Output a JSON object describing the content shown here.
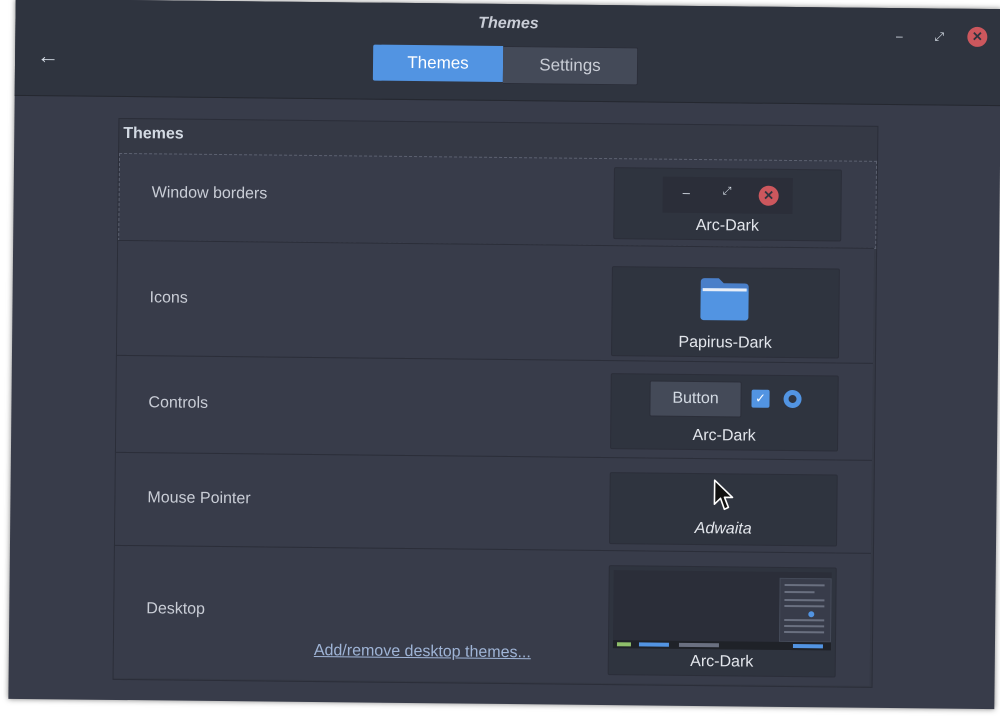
{
  "window": {
    "title": "Themes",
    "controls": {
      "minimize": "–",
      "maximize": "⤢",
      "close": "✕"
    }
  },
  "header": {
    "back_icon": "arrow-left-icon",
    "back_glyph": "←",
    "tabs": [
      {
        "label": "Themes",
        "active": true
      },
      {
        "label": "Settings",
        "active": false
      }
    ]
  },
  "section": {
    "title": "Themes"
  },
  "rows": {
    "window_borders": {
      "label": "Window borders",
      "value": "Arc-Dark"
    },
    "icons": {
      "label": "Icons",
      "value": "Papirus-Dark"
    },
    "controls": {
      "label": "Controls",
      "value": "Arc-Dark",
      "button_label": "Button"
    },
    "mouse_pointer": {
      "label": "Mouse Pointer",
      "value": "Adwaita"
    },
    "desktop": {
      "label": "Desktop",
      "value": "Arc-Dark",
      "link": "Add/remove desktop themes..."
    }
  },
  "colors": {
    "accent": "#5294e2",
    "close": "#cc575d",
    "background": "#383c4a",
    "headerbar": "#2f343f"
  }
}
